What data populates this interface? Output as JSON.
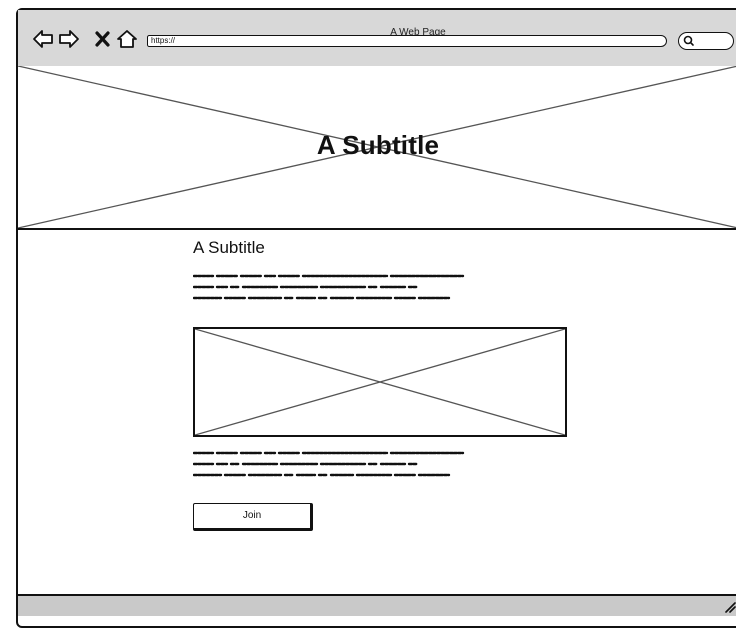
{
  "window": {
    "title": "A Web Page"
  },
  "address_bar": {
    "url": "https://"
  },
  "hero": {
    "title": "A Subtitle"
  },
  "content": {
    "heading": "A Subtitle",
    "button_label": "Join"
  },
  "icons": {
    "back": "back-arrow-icon",
    "forward": "forward-arrow-icon",
    "stop": "close-icon",
    "home": "home-icon",
    "search": "search-icon",
    "resize": "resize-grip-icon"
  },
  "colors": {
    "chrome": "#d8d8d8",
    "statusbar": "#c9c9c9",
    "stroke": "#111111",
    "placeholder_line": "#666666"
  }
}
